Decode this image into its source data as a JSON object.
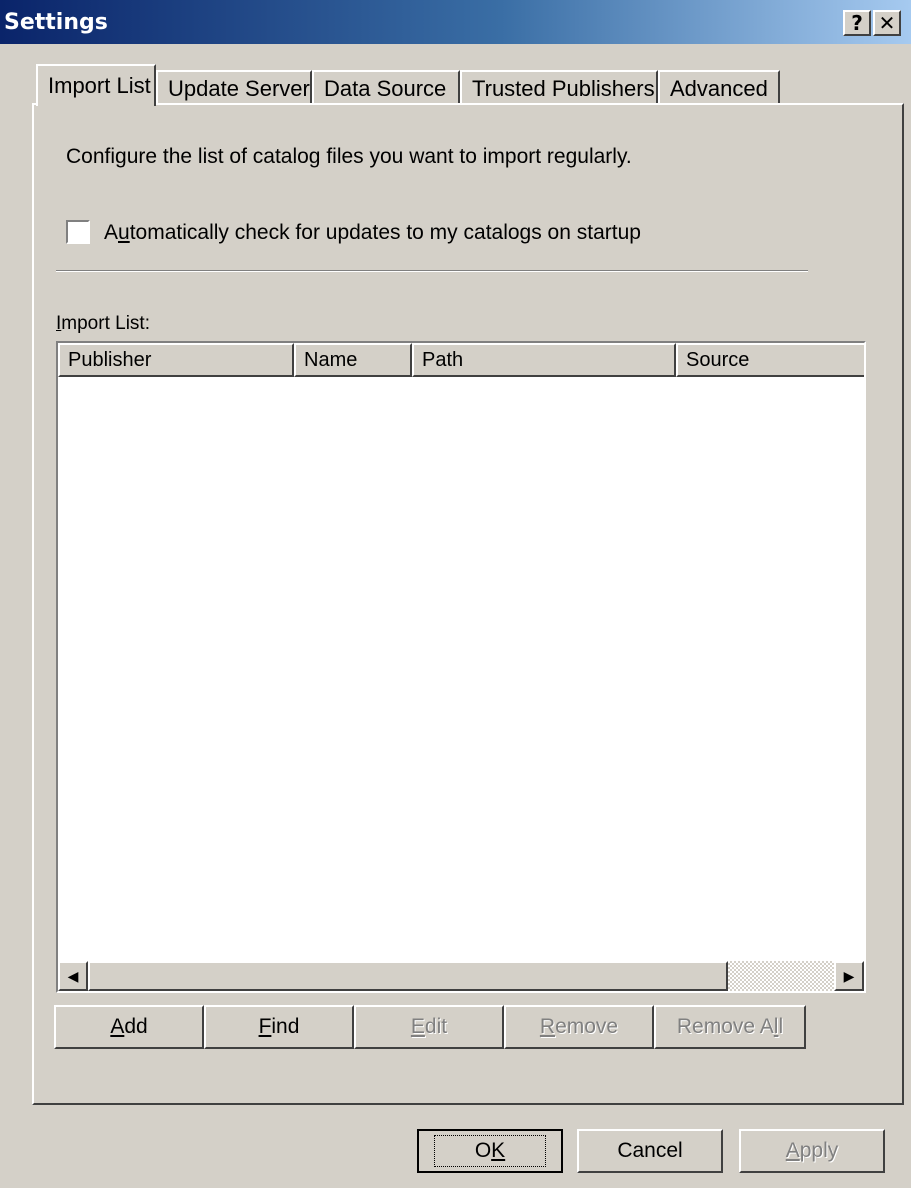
{
  "window": {
    "title": "Settings",
    "help_glyph": "?",
    "close_glyph": "✕"
  },
  "tabs": [
    {
      "label": "Import List",
      "active": true
    },
    {
      "label": "Update Server",
      "active": false
    },
    {
      "label": "Data Source",
      "active": false
    },
    {
      "label": "Trusted Publishers",
      "active": false
    },
    {
      "label": "Advanced",
      "active": false
    }
  ],
  "import_tab": {
    "description": "Configure the list of catalog files you want to import regularly.",
    "auto_check": {
      "label_pre": "A",
      "label_ul": "u",
      "label_post": "tomatically check for updates to my catalogs on startup",
      "checked": false
    },
    "list_label_ul": "I",
    "list_label_rest": "mport List:",
    "columns": [
      "Publisher",
      "Name",
      "Path",
      "Source"
    ],
    "scroll_left_glyph": "◀",
    "scroll_right_glyph": "▶"
  },
  "list_buttons": {
    "add": {
      "ul": "A",
      "rest": "dd",
      "enabled": true
    },
    "find": {
      "ul": "F",
      "rest": "ind",
      "enabled": true
    },
    "edit": {
      "ul": "E",
      "rest": "dit",
      "enabled": false
    },
    "remove": {
      "ul": "R",
      "rest": "emove",
      "enabled": false
    },
    "remove_all": {
      "pre": "Remove A",
      "ul": "l",
      "rest": "l",
      "enabled": false
    }
  },
  "dialog_buttons": {
    "ok": {
      "pre": "O",
      "ul": "K",
      "enabled": true
    },
    "cancel": {
      "label": "Cancel",
      "enabled": true
    },
    "apply": {
      "ul": "A",
      "rest": "pply",
      "enabled": false
    }
  },
  "colors": {
    "face": "#d4d0c8",
    "title_start": "#0a246a",
    "title_end": "#a6caf0",
    "disabled_text": "#808080"
  }
}
